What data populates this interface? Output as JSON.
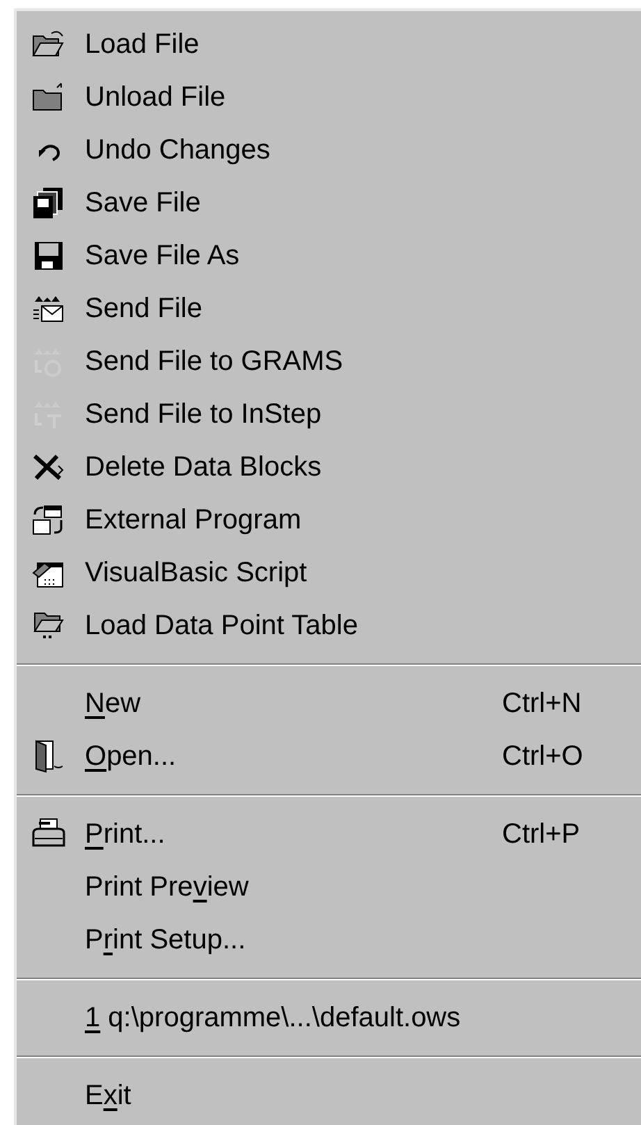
{
  "menu": [
    {
      "kind": "item",
      "label": "Load File",
      "icon_grayed": false
    },
    {
      "kind": "item",
      "label": "Unload File",
      "icon_grayed": false
    },
    {
      "kind": "item",
      "label": "Undo Changes",
      "icon_grayed": false
    },
    {
      "kind": "item",
      "label": "Save File",
      "icon_grayed": false
    },
    {
      "kind": "item",
      "label": "Save File As",
      "icon_grayed": false
    },
    {
      "kind": "item",
      "label": "Send File",
      "icon_grayed": false
    },
    {
      "kind": "item",
      "label": "Send File to GRAMS",
      "icon_grayed": true
    },
    {
      "kind": "item",
      "label": "Send File to InStep",
      "icon_grayed": true
    },
    {
      "kind": "item",
      "label": "Delete Data Blocks",
      "icon_grayed": false
    },
    {
      "kind": "item",
      "label": "External Program",
      "icon_grayed": false
    },
    {
      "kind": "item",
      "label": "VisualBasic Script",
      "icon_grayed": false
    },
    {
      "kind": "item",
      "label": "Load Data Point Table",
      "icon_grayed": false
    },
    {
      "kind": "separator"
    },
    {
      "kind": "item",
      "access_key": "N",
      "text_after": "ew",
      "shortcut": "Ctrl+N"
    },
    {
      "kind": "item",
      "access_key": "O",
      "text_after": "pen...",
      "shortcut": "Ctrl+O",
      "icon_grayed": false
    },
    {
      "kind": "separator"
    },
    {
      "kind": "item",
      "access_key": "P",
      "text_after": "rint...",
      "shortcut": "Ctrl+P",
      "icon_grayed": false
    },
    {
      "kind": "item",
      "text_before": "Print Pre",
      "access_key": "v",
      "text_after": "iew"
    },
    {
      "kind": "item",
      "text_before": "P",
      "access_key": "r",
      "text_after": "int Setup..."
    },
    {
      "kind": "separator"
    },
    {
      "kind": "item",
      "access_key": "1",
      "text_after": " q:\\programme\\...\\default.ows"
    },
    {
      "kind": "separator"
    },
    {
      "kind": "item",
      "text_before": "E",
      "access_key": "x",
      "text_after": "it"
    }
  ]
}
